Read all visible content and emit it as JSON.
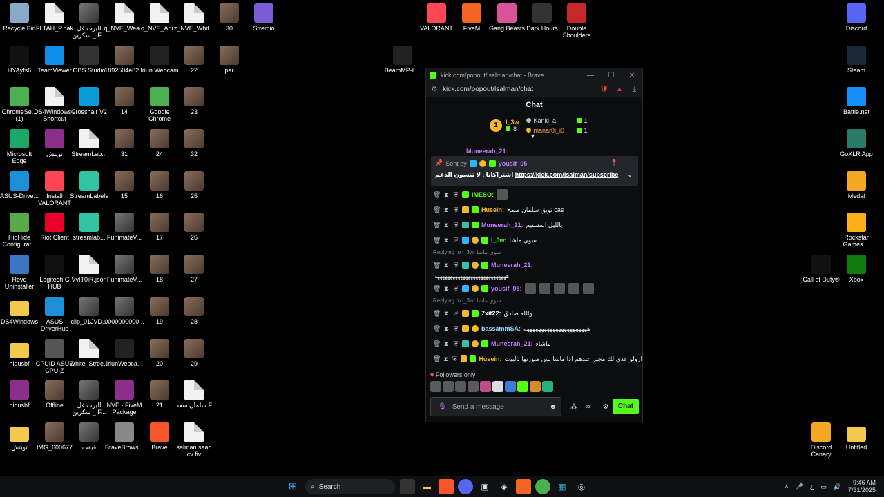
{
  "desktop": {
    "left_icons": [
      {
        "label": "Recycle Bin",
        "icon": "recycle-bin-icon"
      },
      {
        "label": "FLTAH_P.pak",
        "icon": "file-icon"
      },
      {
        "label": "البرت فل سكرين _ F...",
        "icon": "video-file-icon"
      },
      {
        "label": "q_NVE_Wea...",
        "icon": "file-icon"
      },
      {
        "label": "o_NVE_Ani...",
        "icon": "file-icon"
      },
      {
        "label": "z_NVE_Whit...",
        "icon": "file-icon"
      },
      {
        "label": "30",
        "icon": "photo-icon"
      },
      {
        "label": "Stremio",
        "icon": "stremio-icon"
      },
      {
        "label": "HYAyfs6",
        "icon": "app-icon"
      },
      {
        "label": "TeamViewer",
        "icon": "teamviewer-icon"
      },
      {
        "label": "OBS Studio",
        "icon": "obs-icon"
      },
      {
        "label": "1892504e82...",
        "icon": "photo-icon"
      },
      {
        "label": "Iriun Webcam",
        "icon": "webcam-icon"
      },
      {
        "label": "22",
        "icon": "photo-icon"
      },
      {
        "label": "par",
        "icon": "photo-icon"
      },
      {
        "label": "ChromeSe... (1)",
        "icon": "chrome-setup-icon"
      },
      {
        "label": "DS4Windows - Shortcut",
        "icon": "file-icon"
      },
      {
        "label": "Crosshair V2",
        "icon": "crosshair-icon"
      },
      {
        "label": "14",
        "icon": "photo-icon"
      },
      {
        "label": "Google Chrome",
        "icon": "chrome-icon"
      },
      {
        "label": "23",
        "icon": "photo-icon"
      },
      {
        "label": "Microsoft Edge",
        "icon": "edge-icon"
      },
      {
        "label": "تويتش",
        "icon": "winrar-icon"
      },
      {
        "label": "StreamLab...",
        "icon": "file-icon"
      },
      {
        "label": "31",
        "icon": "photo-icon"
      },
      {
        "label": "24",
        "icon": "photo-icon"
      },
      {
        "label": "32",
        "icon": "photo-icon"
      },
      {
        "label": "ASUS-Drive...",
        "icon": "asus-icon"
      },
      {
        "label": "Install VALORANT",
        "icon": "valorant-icon"
      },
      {
        "label": "StreamLabels",
        "icon": "streamlabels-icon"
      },
      {
        "label": "15",
        "icon": "photo-icon"
      },
      {
        "label": "16",
        "icon": "photo-icon"
      },
      {
        "label": "25",
        "icon": "photo-icon"
      },
      {
        "label": "HidHide Configurat...",
        "icon": "hidhide-icon"
      },
      {
        "label": "Riot Client",
        "icon": "riot-icon"
      },
      {
        "label": "streamlab...",
        "icon": "streamlabels-icon"
      },
      {
        "label": "FunimateV...",
        "icon": "video-file-icon"
      },
      {
        "label": "17",
        "icon": "photo-icon"
      },
      {
        "label": "26",
        "icon": "photo-icon"
      },
      {
        "label": "Revo Uninstaller",
        "icon": "revo-icon"
      },
      {
        "label": "Logitech G HUB",
        "icon": "logitech-icon"
      },
      {
        "label": "VvIT0iR.json",
        "icon": "file-icon"
      },
      {
        "label": "FunimateV...",
        "icon": "video-file-icon"
      },
      {
        "label": "18",
        "icon": "photo-icon"
      },
      {
        "label": "27",
        "icon": "photo-icon"
      },
      {
        "label": "DS4Windows",
        "icon": "folder-icon"
      },
      {
        "label": "ASUS DriverHub",
        "icon": "asus-driverhub-icon"
      },
      {
        "label": "clip_01JVD...",
        "icon": "video-file-icon"
      },
      {
        "label": "0000000000...",
        "icon": "video-file-icon"
      },
      {
        "label": "19",
        "icon": "photo-icon"
      },
      {
        "label": "28",
        "icon": "photo-icon"
      },
      {
        "label": "hidusbf",
        "icon": "folder-icon"
      },
      {
        "label": "CPUID ASUS CPU-Z",
        "icon": "cpuz-icon"
      },
      {
        "label": "White_Stree...",
        "icon": "file-icon"
      },
      {
        "label": "IriunWebca...",
        "icon": "webcam-icon"
      },
      {
        "label": "20",
        "icon": "photo-icon"
      },
      {
        "label": "29",
        "icon": "photo-icon"
      },
      {
        "label": "hidusbf",
        "icon": "winrar-icon"
      },
      {
        "label": "Offline",
        "icon": "photo-icon"
      },
      {
        "label": "البرت فل سكرين _ F...",
        "icon": "video-file-icon"
      },
      {
        "label": "NVE - FiveM Package",
        "icon": "winrar-icon"
      },
      {
        "label": "21",
        "icon": "photo-icon"
      },
      {
        "label": "سلمان سعد F",
        "icon": "pdf-icon"
      },
      {
        "label": "تويتش",
        "icon": "folder-icon"
      },
      {
        "label": "IMG_600677",
        "icon": "photo-icon"
      },
      {
        "label": "قيقت",
        "icon": "video-file-icon"
      },
      {
        "label": "BraveBrows...",
        "icon": "brave-setup-icon"
      },
      {
        "label": "Brave",
        "icon": "brave-icon"
      },
      {
        "label": "salman saad cv fiv",
        "icon": "pdf-icon"
      }
    ],
    "top_icons": [
      {
        "label": "VALORANT",
        "icon": "valorant-icon"
      },
      {
        "label": "FiveM",
        "icon": "fivem-icon"
      },
      {
        "label": "Gang Beasts",
        "icon": "gangbeasts-icon"
      },
      {
        "label": "Dark Hours",
        "icon": "darkhours-icon"
      },
      {
        "label": "Double Shoulders",
        "icon": "doubleshoulders-icon"
      },
      {
        "label": "BeamMP-L...",
        "icon": "beammp-icon"
      }
    ],
    "right_icons": [
      {
        "label": "Discord",
        "icon": "discord-icon"
      },
      {
        "label": "Steam",
        "icon": "steam-icon"
      },
      {
        "label": "Battle.net",
        "icon": "battlenet-icon"
      },
      {
        "label": "GoXLR App",
        "icon": "goxlr-icon"
      },
      {
        "label": "Medal",
        "icon": "medal-icon"
      },
      {
        "label": "Rockstar Games ...",
        "icon": "rockstar-icon"
      },
      {
        "label": "Call of Duty®",
        "icon": "cod-icon"
      },
      {
        "label": "Xbox",
        "icon": "xbox-icon"
      },
      {
        "label": "Discord Canary",
        "icon": "discord-canary-icon"
      },
      {
        "label": "Untitled",
        "icon": "folder-icon"
      }
    ]
  },
  "browser": {
    "title": "kick.com/popout/lsalman/chat - Brave",
    "url": "kick.com/popout/lsalman/chat",
    "min": "—",
    "max": "☐",
    "close": "✕"
  },
  "chat": {
    "header": "Chat",
    "leaderboard": {
      "top_rank": "1",
      "top_name": "l_3w",
      "top_count": "8",
      "others": [
        {
          "name": "Kanki_a",
          "count": "1"
        },
        {
          "name": "manar0i_i0",
          "count": "1"
        }
      ]
    },
    "pinned": {
      "sent_by": "Sent by",
      "user": "yousif_05",
      "text": "اشتراكاتا , لا تنسون الدعم",
      "link": "https://kick.com/lsalman/subscribe"
    },
    "partial_top_user": "Muneerah_21:",
    "messages": [
      {
        "user": "iMESO:",
        "text": "",
        "color": "#53fc18",
        "badges": [
          "sub"
        ],
        "emotes": 1
      },
      {
        "user": "Husein:",
        "text": "تويق سلمان صمح cas",
        "color": "#f5b72b",
        "badges": [
          "crown",
          "sub"
        ],
        "emotes": 0
      },
      {
        "user": "Muneerah_21:",
        "text": "يالليل المسنيم",
        "color": "#c07cff",
        "badges": [
          "vip",
          "sub"
        ],
        "emotes": 0
      },
      {
        "user": "l_3w:",
        "text": "سوي ماشا",
        "color": "#53fc18",
        "badges": [
          "gift",
          "coin",
          "sub"
        ],
        "emotes": 0
      },
      {
        "reply": "Replying to l_3w: سوي ماشا"
      },
      {
        "user": "Muneerah_21:",
        "text": "",
        "color": "#c07cff",
        "badges": [
          "vip",
          "coin",
          "sub"
        ],
        "emotes": 0
      },
      {
        "wrap": "ههههههههههههههههههههههههههههه"
      },
      {
        "user": "yousif_05:",
        "text": "",
        "color": "#c07cff",
        "badges": [
          "gift",
          "coin",
          "sub"
        ],
        "emotes": 5
      },
      {
        "reply": "Replying to l_3w: سوي ماشا"
      },
      {
        "user": "7xit22:",
        "text": "والله صادق",
        "color": "#ffffff",
        "badges": [
          "crown",
          "sub"
        ],
        "emotes": 0
      },
      {
        "user": "bassammSA:",
        "text": "ههههههههههههههههههههههه",
        "color": "#9ad8ff",
        "badges": [
          "crown",
          "coin"
        ],
        "emotes": 0
      },
      {
        "user": "Muneerah_21:",
        "text": "ماشاء",
        "color": "#c07cff",
        "badges": [
          "vip",
          "coin",
          "sub"
        ],
        "emotes": 0
      },
      {
        "user": "Husein:",
        "text": "ارولو عدي لك مجير عندهم اذا ماشا بس صورتها بالبيت",
        "color": "#f5b72b",
        "badges": [
          "crown",
          "sub"
        ],
        "emotes": 0
      }
    ],
    "followers_only": "Followers only",
    "input_placeholder": "Send a message",
    "send_label": "Chat"
  },
  "taskbar": {
    "search_label": "Search",
    "lang": "ع",
    "time": "9:46 AM",
    "date": "7/31/2025"
  },
  "colors": {
    "kick_green": "#53fc18",
    "gold": "#f5b72b",
    "purple": "#c07cff"
  }
}
